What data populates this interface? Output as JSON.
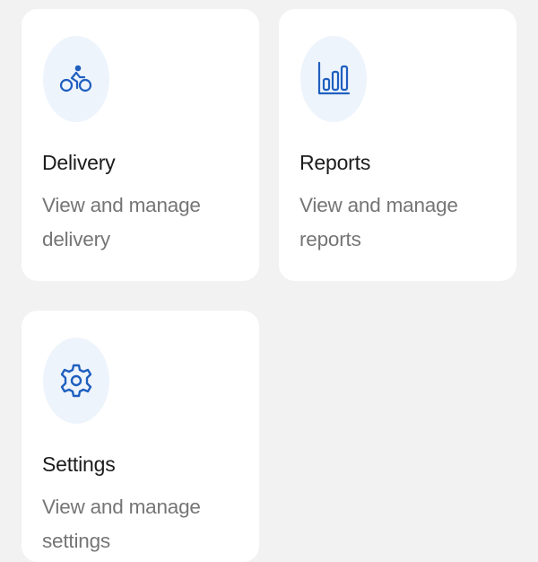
{
  "colors": {
    "page_background": "#f2f2f2",
    "card_background": "#ffffff",
    "icon_circle": "#eef4fc",
    "icon_accent": "#1f5fbf",
    "title_text": "#1c1c1c",
    "description_text": "#757575"
  },
  "cards": [
    {
      "icon": "bicycle-icon",
      "title": "Delivery",
      "description": "View and manage delivery"
    },
    {
      "icon": "bar-chart-icon",
      "title": "Reports",
      "description": "View and manage reports"
    },
    {
      "icon": "gear-icon",
      "title": "Settings",
      "description": "View and manage settings"
    }
  ]
}
